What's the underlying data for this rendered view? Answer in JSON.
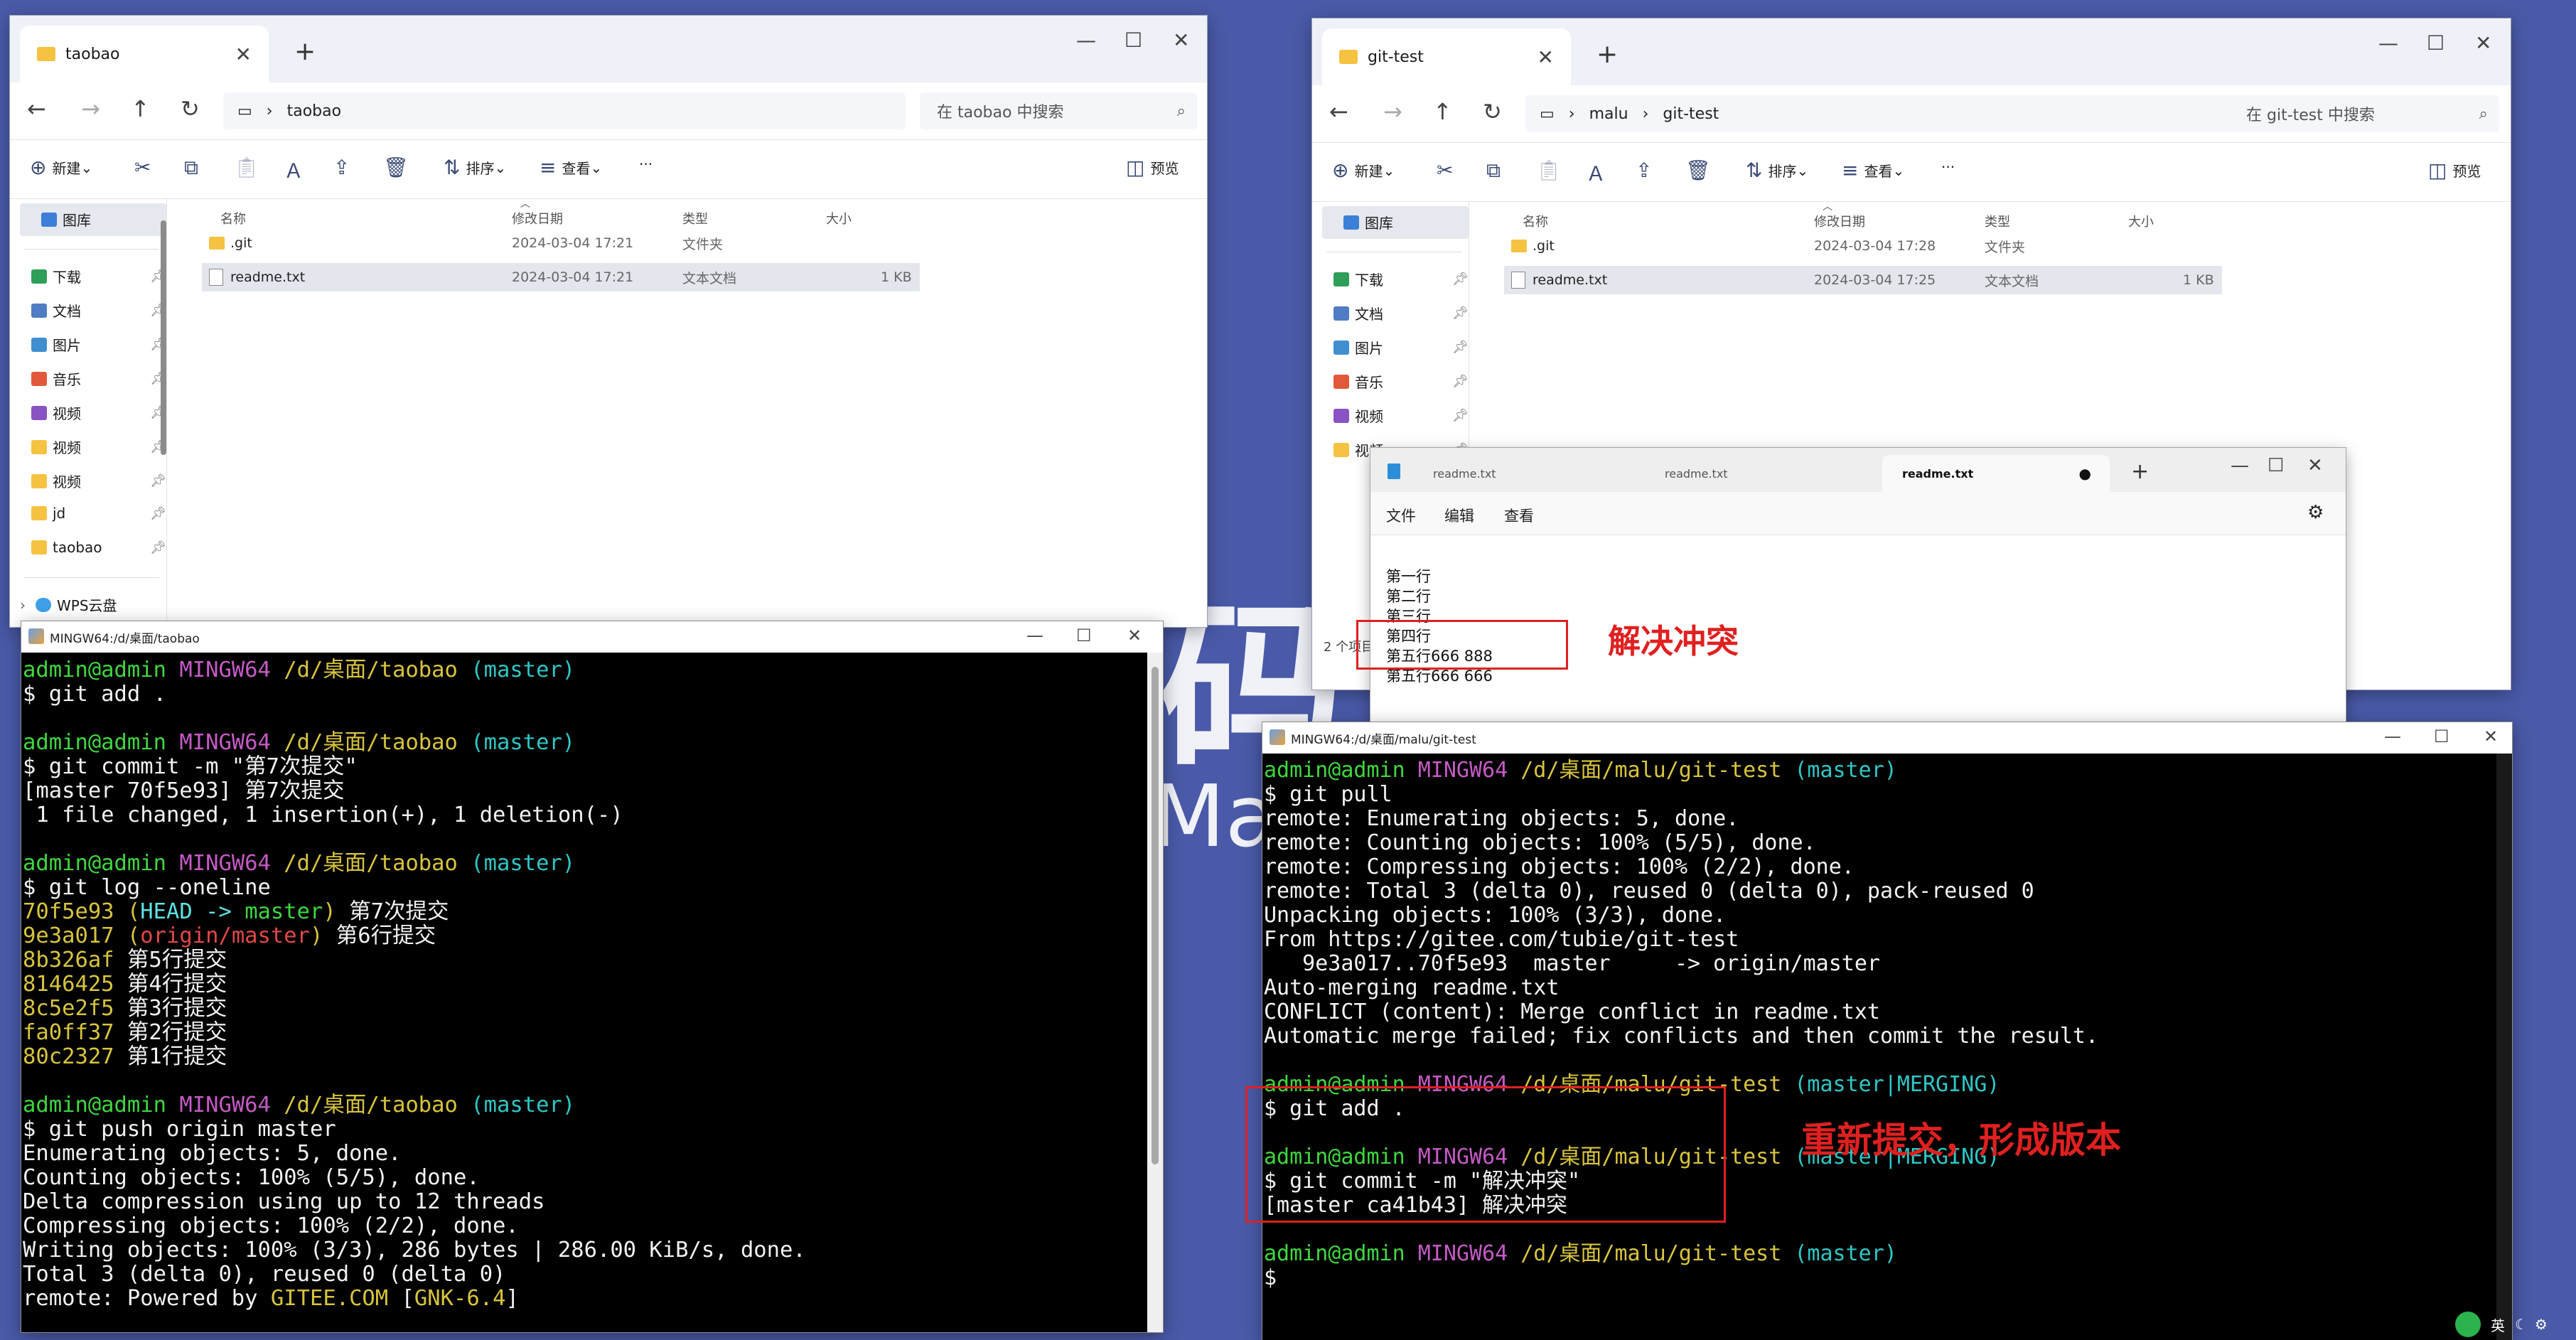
{
  "desktop": {
    "bg_big": "码上",
    "bg_small": "Mal"
  },
  "explorer_left": {
    "tab_title": "taobao",
    "breadcrumb": [
      "taobao"
    ],
    "search_placeholder": "在 taobao 中搜索",
    "toolbar": {
      "new": "新建",
      "sort": "排序",
      "view": "查看",
      "more": "···",
      "preview": "预览"
    },
    "sidebar": [
      {
        "label": "图库",
        "color": "#3b7fd8",
        "pin": false
      },
      {
        "label": "下载",
        "color": "#2f9e59",
        "pin": true
      },
      {
        "label": "文档",
        "color": "#4f7cc4",
        "pin": true
      },
      {
        "label": "图片",
        "color": "#3f8fd0",
        "pin": true
      },
      {
        "label": "音乐",
        "color": "#e2593a",
        "pin": true
      },
      {
        "label": "视频",
        "color": "#8a53c4",
        "pin": true
      },
      {
        "label": "视频",
        "color": "#f5c242",
        "pin": true
      },
      {
        "label": "视频",
        "color": "#f5c242",
        "pin": true
      },
      {
        "label": "jd",
        "color": "#f5c242",
        "pin": true
      },
      {
        "label": "taobao",
        "color": "#f5c242",
        "pin": true
      },
      {
        "label": "WPS云盘",
        "color": "#3fa0e8",
        "pin": false
      }
    ],
    "columns": {
      "name": "名称",
      "modified": "修改日期",
      "type": "类型",
      "size": "大小"
    },
    "files": [
      {
        "name": ".git",
        "modified": "2024-03-04 17:21",
        "type": "文件夹",
        "size": ""
      },
      {
        "name": "readme.txt",
        "modified": "2024-03-04 17:21",
        "type": "文本文档",
        "size": "1 KB"
      }
    ]
  },
  "explorer_right": {
    "tab_title": "git-test",
    "breadcrumb": [
      "malu",
      "git-test"
    ],
    "search_placeholder": "在 git-test 中搜索",
    "toolbar": {
      "new": "新建",
      "sort": "排序",
      "view": "查看",
      "more": "···",
      "preview": "预览"
    },
    "sidebar": [
      {
        "label": "图库",
        "color": "#3b7fd8",
        "pin": false
      },
      {
        "label": "下载",
        "color": "#2f9e59",
        "pin": true
      },
      {
        "label": "文档",
        "color": "#4f7cc4",
        "pin": true
      },
      {
        "label": "图片",
        "color": "#3f8fd0",
        "pin": true
      },
      {
        "label": "音乐",
        "color": "#e2593a",
        "pin": true
      },
      {
        "label": "视频",
        "color": "#8a53c4",
        "pin": true
      },
      {
        "label": "视频",
        "color": "#f5c242",
        "pin": true
      }
    ],
    "columns": {
      "name": "名称",
      "modified": "修改日期",
      "type": "类型",
      "size": "大小"
    },
    "files": [
      {
        "name": ".git",
        "modified": "2024-03-04 17:28",
        "type": "文件夹",
        "size": ""
      },
      {
        "name": "readme.txt",
        "modified": "2024-03-04 17:25",
        "type": "文本文档",
        "size": "1 KB"
      }
    ],
    "status": "2 个项目"
  },
  "notepad": {
    "tabs": [
      "readme.txt",
      "readme.txt",
      "readme.txt"
    ],
    "menu": {
      "file": "文件",
      "edit": "编辑",
      "view": "查看"
    },
    "lines": [
      "第一行",
      "第二行",
      "第三行",
      "第四行",
      "第五行666 888",
      "第五行666 666"
    ]
  },
  "annotations": {
    "resolve": "解决冲突",
    "recommit": "重新提交，形成版本"
  },
  "term_left": {
    "title": "MINGW64:/d/桌面/taobao",
    "lines": [
      [
        [
          "admin@admin ",
          "c-green"
        ],
        [
          "MINGW64 ",
          "c-mag"
        ],
        [
          "/d/桌面/taobao ",
          "c-yel"
        ],
        [
          "(master)",
          "c-cyan"
        ]
      ],
      [
        [
          "$ git add .",
          "c-white"
        ]
      ],
      [
        [
          "",
          ""
        ]
      ],
      [
        [
          "admin@admin ",
          "c-green"
        ],
        [
          "MINGW64 ",
          "c-mag"
        ],
        [
          "/d/桌面/taobao ",
          "c-yel"
        ],
        [
          "(master)",
          "c-cyan"
        ]
      ],
      [
        [
          "$ git commit -m \"第7次提交\"",
          "c-white"
        ]
      ],
      [
        [
          "[master 70f5e93] 第7次提交",
          "c-white"
        ]
      ],
      [
        [
          " 1 file changed, 1 insertion(+), 1 deletion(-)",
          "c-white"
        ]
      ],
      [
        [
          "",
          ""
        ]
      ],
      [
        [
          "admin@admin ",
          "c-green"
        ],
        [
          "MINGW64 ",
          "c-mag"
        ],
        [
          "/d/桌面/taobao ",
          "c-yel"
        ],
        [
          "(master)",
          "c-cyan"
        ]
      ],
      [
        [
          "$ git log --oneline",
          "c-white"
        ]
      ],
      [
        [
          "70f5e93 ",
          "c-yel"
        ],
        [
          "(",
          "c-yel"
        ],
        [
          "HEAD -> ",
          "c-bcyan"
        ],
        [
          "master",
          "c-green"
        ],
        [
          ")",
          "c-yel"
        ],
        [
          " 第7次提交",
          "c-white"
        ]
      ],
      [
        [
          "9e3a017 ",
          "c-yel"
        ],
        [
          "(",
          "c-yel"
        ],
        [
          "origin/master",
          "c-red"
        ],
        [
          ")",
          "c-yel"
        ],
        [
          " 第6行提交",
          "c-white"
        ]
      ],
      [
        [
          "8b326af ",
          "c-yel"
        ],
        [
          "第5行提交",
          "c-white"
        ]
      ],
      [
        [
          "8146425 ",
          "c-yel"
        ],
        [
          "第4行提交",
          "c-white"
        ]
      ],
      [
        [
          "8c5e2f5 ",
          "c-yel"
        ],
        [
          "第3行提交",
          "c-white"
        ]
      ],
      [
        [
          "fa0ff37 ",
          "c-yel"
        ],
        [
          "第2行提交",
          "c-white"
        ]
      ],
      [
        [
          "80c2327 ",
          "c-yel"
        ],
        [
          "第1行提交",
          "c-white"
        ]
      ],
      [
        [
          "",
          ""
        ]
      ],
      [
        [
          "admin@admin ",
          "c-green"
        ],
        [
          "MINGW64 ",
          "c-mag"
        ],
        [
          "/d/桌面/taobao ",
          "c-yel"
        ],
        [
          "(master)",
          "c-cyan"
        ]
      ],
      [
        [
          "$ git push origin master",
          "c-white"
        ]
      ],
      [
        [
          "Enumerating objects: 5, done.",
          "c-white"
        ]
      ],
      [
        [
          "Counting objects: 100% (5/5), done.",
          "c-white"
        ]
      ],
      [
        [
          "Delta compression using up to 12 threads",
          "c-white"
        ]
      ],
      [
        [
          "Compressing objects: 100% (2/2), done.",
          "c-white"
        ]
      ],
      [
        [
          "Writing objects: 100% (3/3), 286 bytes | 286.00 KiB/s, done.",
          "c-white"
        ]
      ],
      [
        [
          "Total 3 (delta 0), reused 0 (delta 0)",
          "c-white"
        ]
      ],
      [
        [
          "remote: Powered by ",
          "c-white"
        ],
        [
          "GITEE.COM ",
          "c-yel"
        ],
        [
          "[",
          "c-white"
        ],
        [
          "GNK-6.4",
          "c-yel"
        ],
        [
          "]",
          "c-white"
        ]
      ]
    ]
  },
  "term_right": {
    "title": "MINGW64:/d/桌面/malu/git-test",
    "lines": [
      [
        [
          "admin@admin ",
          "c-green"
        ],
        [
          "MINGW64 ",
          "c-mag"
        ],
        [
          "/d/桌面/malu/git-test ",
          "c-yel"
        ],
        [
          "(master)",
          "c-cyan"
        ]
      ],
      [
        [
          "$ git pull",
          "c-white"
        ]
      ],
      [
        [
          "remote: Enumerating objects: 5, done.",
          "c-white"
        ]
      ],
      [
        [
          "remote: Counting objects: 100% (5/5), done.",
          "c-white"
        ]
      ],
      [
        [
          "remote: Compressing objects: 100% (2/2), done.",
          "c-white"
        ]
      ],
      [
        [
          "remote: Total 3 (delta 0), reused 0 (delta 0), pack-reused 0",
          "c-white"
        ]
      ],
      [
        [
          "Unpacking objects: 100% (3/3), done.",
          "c-white"
        ]
      ],
      [
        [
          "From https://gitee.com/tubie/git-test",
          "c-white"
        ]
      ],
      [
        [
          "   9e3a017..70f5e93  master     -> origin/master",
          "c-white"
        ]
      ],
      [
        [
          "Auto-merging readme.txt",
          "c-white"
        ]
      ],
      [
        [
          "CONFLICT (content): Merge conflict in readme.txt",
          "c-white"
        ]
      ],
      [
        [
          "Automatic merge failed; fix conflicts and then commit the result.",
          "c-white"
        ]
      ],
      [
        [
          "",
          ""
        ]
      ],
      [
        [
          "admin@admin ",
          "c-green"
        ],
        [
          "MINGW64 ",
          "c-mag"
        ],
        [
          "/d/桌面/malu/git-test ",
          "c-yel"
        ],
        [
          "(master|MERGING)",
          "c-cyan"
        ]
      ],
      [
        [
          "$ git add .",
          "c-white"
        ]
      ],
      [
        [
          "",
          ""
        ]
      ],
      [
        [
          "admin@admin ",
          "c-green"
        ],
        [
          "MINGW64 ",
          "c-mag"
        ],
        [
          "/d/桌面/malu/git-test ",
          "c-yel"
        ],
        [
          "(master|MERGING)",
          "c-cyan"
        ]
      ],
      [
        [
          "$ git commit -m \"解决冲突\"",
          "c-white"
        ]
      ],
      [
        [
          "[master ca41b43] 解决冲突",
          "c-white"
        ]
      ],
      [
        [
          "",
          ""
        ]
      ],
      [
        [
          "admin@admin ",
          "c-green"
        ],
        [
          "MINGW64 ",
          "c-mag"
        ],
        [
          "/d/桌面/malu/git-test ",
          "c-yel"
        ],
        [
          "(master)",
          "c-cyan"
        ]
      ],
      [
        [
          "$ ",
          "c-white"
        ]
      ]
    ]
  },
  "tray": {
    "ime": "英"
  }
}
